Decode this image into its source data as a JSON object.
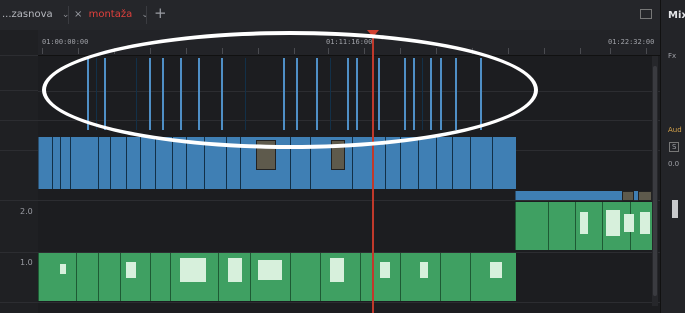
{
  "tabs": [
    {
      "label": "...zasnova",
      "active": false
    },
    {
      "label": "montaža",
      "active": true
    }
  ],
  "tab_chevron": "⌄",
  "tab_close": "×",
  "new_tab": "+",
  "ruler": {
    "timecodes": [
      "01:00:00:00",
      "01:11:16:00",
      "01:22:32:00"
    ]
  },
  "track_labels": {
    "audio2": "2.0",
    "audio1": "1.0"
  },
  "mixer": {
    "title": "Mix",
    "fx_label": "Fx",
    "audio_label": "Aud",
    "solo_label": "S",
    "level_value": "0.0"
  },
  "colors": {
    "video_clip": "#3f7fb4",
    "audio_clip": "#3fa062",
    "playhead": "#c0392b",
    "active_tab": "#e0403c",
    "annotation": "#ffffff"
  }
}
